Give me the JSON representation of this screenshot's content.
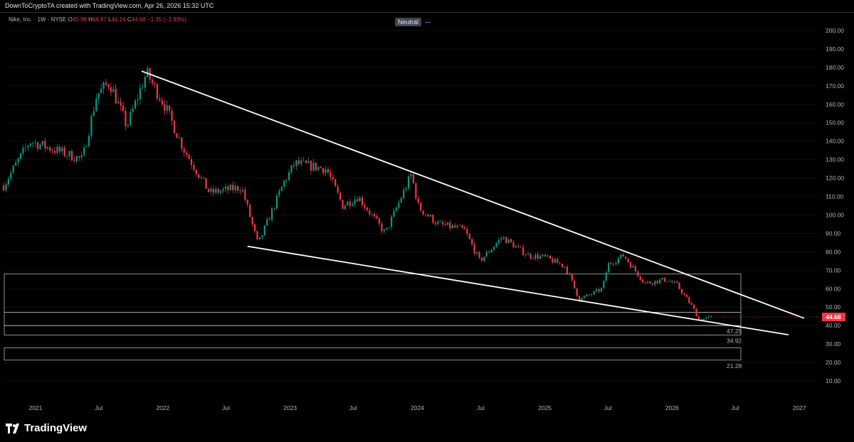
{
  "header": {
    "credit": "DownToCryptoTA created with TradingView.com, Apr 26, 2026 15:32 UTC"
  },
  "legend": {
    "symbol": "Nike, Inc. · 1W · NYSE",
    "open_label": "O",
    "open": "45.98",
    "high_label": "H",
    "high": "46.97",
    "low_label": "L",
    "low": "44.24",
    "close_label": "C",
    "close": "44.68",
    "change": "−1.35 (−2.93%)"
  },
  "indicator_badge": "Neutral",
  "brand": {
    "name": "TradingView",
    "icon": "tradingview-logo-icon"
  },
  "colors": {
    "up": "#089981",
    "down": "#f23645",
    "trendline": "#ffffff",
    "zone": "#b2b5be",
    "price_label": "#f23645"
  },
  "chart_data": {
    "type": "candlestick",
    "interval": "1W",
    "y_ticks": [
      "200.00",
      "190.00",
      "180.00",
      "170.00",
      "160.00",
      "150.00",
      "140.00",
      "130.00",
      "120.00",
      "110.00",
      "100.00",
      "90.00",
      "80.00",
      "70.00",
      "60.00",
      "50.00",
      "40.00",
      "30.00",
      "20.00",
      "10.00"
    ],
    "ylim": [
      0,
      205
    ],
    "x_ticks": [
      "2021",
      "Jul",
      "2022",
      "Jul",
      "2023",
      "Jul",
      "2024",
      "Jul",
      "2025",
      "Jul",
      "2026",
      "Jul",
      "2027"
    ],
    "xlim": [
      "2020-10-01",
      "2027-03-01"
    ],
    "last_price": "44.68",
    "anchors": [
      {
        "date": "2020-10-01",
        "price": 116
      },
      {
        "date": "2020-12-15",
        "price": 140
      },
      {
        "date": "2021-03-01",
        "price": 135
      },
      {
        "date": "2021-05-15",
        "price": 130
      },
      {
        "date": "2021-06-25",
        "price": 165
      },
      {
        "date": "2021-08-01",
        "price": 172
      },
      {
        "date": "2021-09-20",
        "price": 148
      },
      {
        "date": "2021-11-15",
        "price": 177
      },
      {
        "date": "2022-01-05",
        "price": 160
      },
      {
        "date": "2022-03-01",
        "price": 136
      },
      {
        "date": "2022-05-15",
        "price": 112
      },
      {
        "date": "2022-08-15",
        "price": 115
      },
      {
        "date": "2022-10-01",
        "price": 84
      },
      {
        "date": "2022-12-15",
        "price": 118
      },
      {
        "date": "2023-01-15",
        "price": 128
      },
      {
        "date": "2023-04-15",
        "price": 125
      },
      {
        "date": "2023-06-01",
        "price": 105
      },
      {
        "date": "2023-07-15",
        "price": 110
      },
      {
        "date": "2023-10-01",
        "price": 90
      },
      {
        "date": "2023-12-15",
        "price": 122
      },
      {
        "date": "2024-01-05",
        "price": 104
      },
      {
        "date": "2024-03-01",
        "price": 95
      },
      {
        "date": "2024-05-15",
        "price": 92
      },
      {
        "date": "2024-06-28",
        "price": 75
      },
      {
        "date": "2024-09-01",
        "price": 88
      },
      {
        "date": "2024-11-15",
        "price": 78
      },
      {
        "date": "2025-01-01",
        "price": 77
      },
      {
        "date": "2025-03-01",
        "price": 72
      },
      {
        "date": "2025-04-10",
        "price": 54
      },
      {
        "date": "2025-06-15",
        "price": 60
      },
      {
        "date": "2025-07-01",
        "price": 73
      },
      {
        "date": "2025-08-15",
        "price": 78
      },
      {
        "date": "2025-10-15",
        "price": 63
      },
      {
        "date": "2025-12-15",
        "price": 65
      },
      {
        "date": "2026-01-15",
        "price": 62
      },
      {
        "date": "2026-03-01",
        "price": 50
      },
      {
        "date": "2026-03-20",
        "price": 43
      },
      {
        "date": "2026-04-24",
        "price": 44.68
      }
    ],
    "trendlines": [
      {
        "name": "upper",
        "from": {
          "date": "2021-11-01",
          "price": 178
        },
        "to": {
          "date": "2027-01-15",
          "price": 44
        }
      },
      {
        "name": "lower",
        "from": {
          "date": "2022-09-01",
          "price": 83
        },
        "to": {
          "date": "2026-12-01",
          "price": 35
        }
      }
    ],
    "zones": [
      {
        "top": 68,
        "bottom": 47.25,
        "label": ""
      },
      {
        "top": 47.25,
        "bottom": 40,
        "label": "47.25"
      },
      {
        "top": 40,
        "bottom": 34.92,
        "label": "34.92"
      },
      {
        "top": 28,
        "bottom": 21.28,
        "label": "21.28"
      }
    ]
  }
}
